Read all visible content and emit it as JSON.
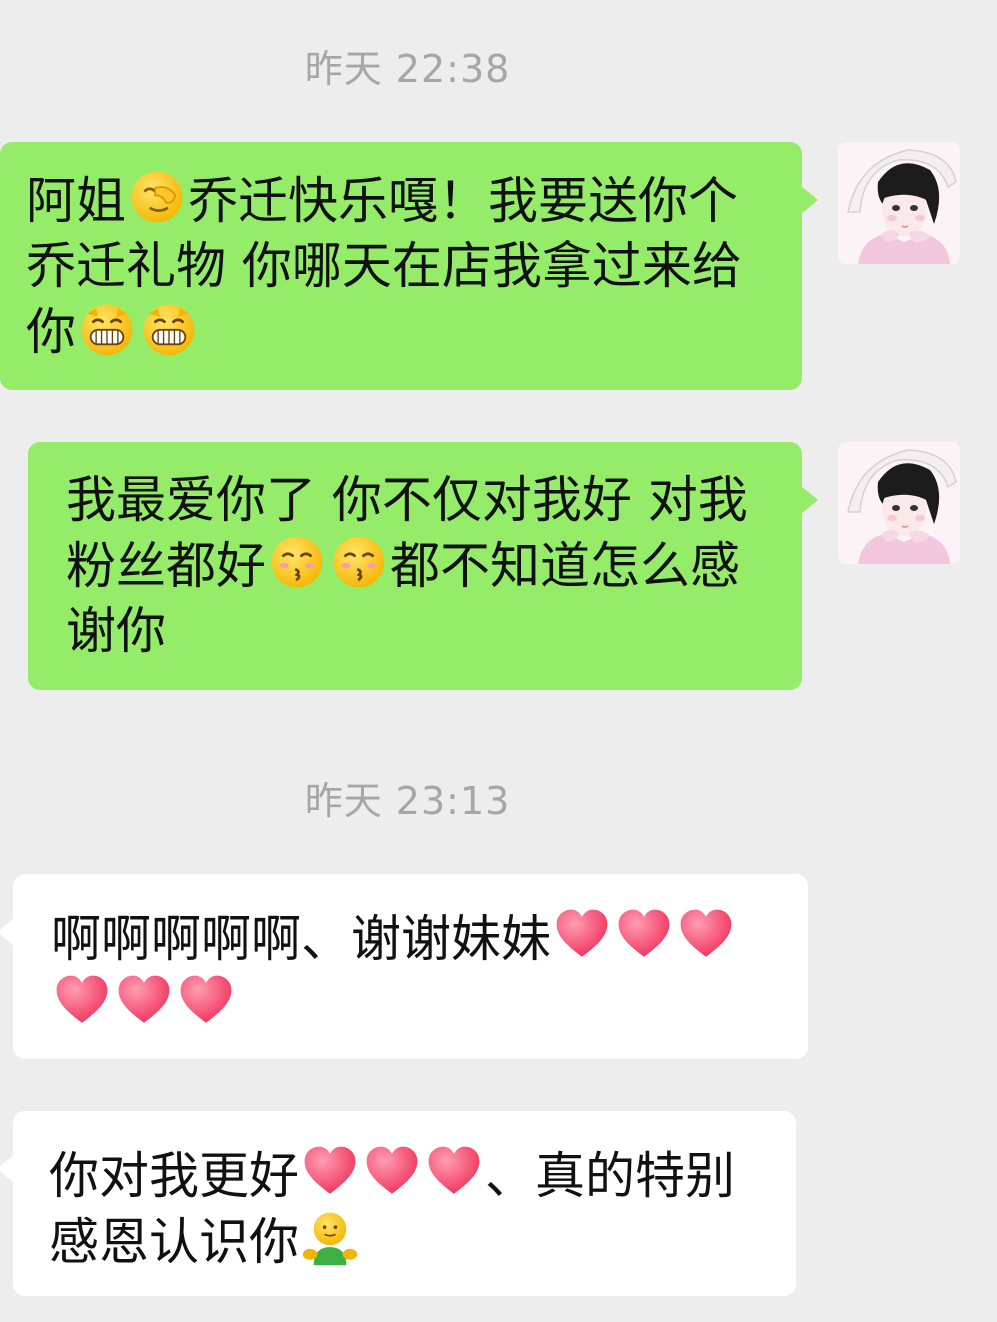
{
  "chat": {
    "timestamps": [
      "昨天 22:38",
      "昨天 23:13"
    ],
    "messages": [
      {
        "side": "sent",
        "parts": [
          "阿姐",
          "乔迁快乐嘎！我要送你个乔迁礼物 你哪天在店我拿过来给你"
        ],
        "emojis": [
          "facepalm-emoji",
          "grin-emoji",
          "grin-emoji"
        ]
      },
      {
        "side": "sent",
        "parts": [
          "我最爱你了 你不仅对我好 对我粉丝都好",
          "都不知道怎么感谢你"
        ],
        "emojis": [
          "kiss-emoji",
          "kiss-emoji"
        ]
      },
      {
        "side": "received",
        "parts": [
          " 啊啊啊啊啊、谢谢妹妹"
        ],
        "emojis": [
          "heart-emoji",
          "heart-emoji",
          "heart-emoji",
          "heart-emoji",
          "heart-emoji",
          "heart-emoji"
        ]
      },
      {
        "side": "received",
        "parts": [
          "你对我更好",
          "、真的特别感恩认识你"
        ],
        "emojis": [
          "heart-emoji",
          "heart-emoji",
          "heart-emoji",
          "hug-emoji"
        ]
      }
    ]
  },
  "colors": {
    "background": "#ededed",
    "sent_bubble": "#95ec69",
    "received_bubble": "#ffffff",
    "timestamp_text": "#a6a6a6"
  }
}
